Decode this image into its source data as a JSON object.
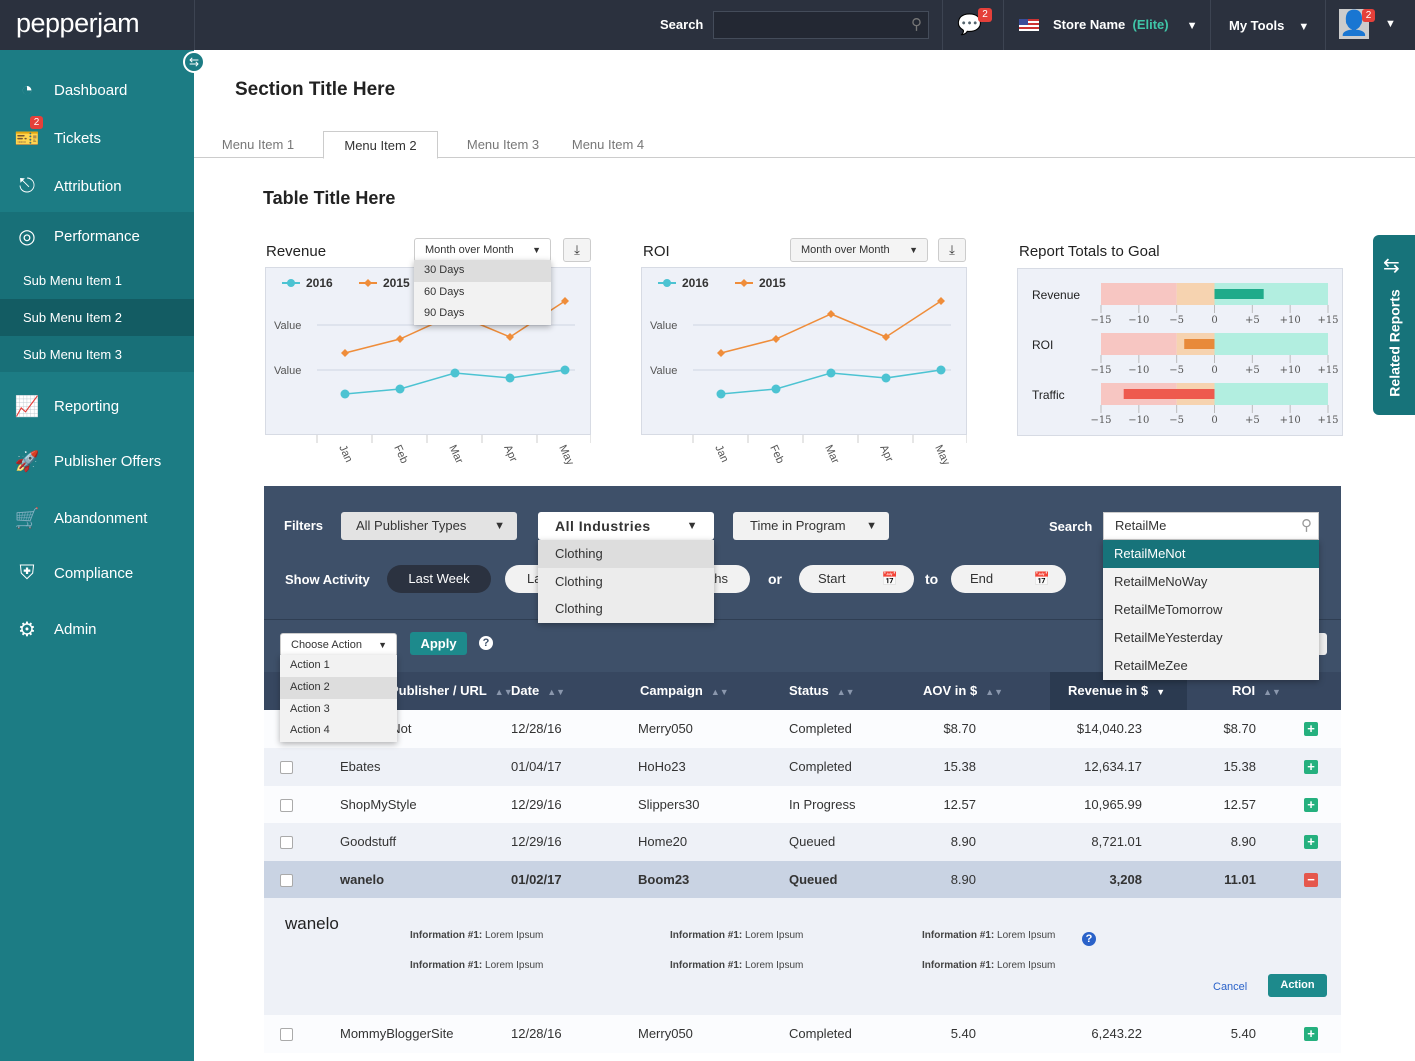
{
  "header": {
    "logo": "pepperjam",
    "search_label": "Search",
    "search_value": "",
    "messages_badge": "2",
    "store_name": "Store Name",
    "store_tier": "(Elite)",
    "my_tools": "My Tools",
    "avatar_badge": "2"
  },
  "sidebar": {
    "items": [
      {
        "label": "Dashboard",
        "icon": "gauge-icon"
      },
      {
        "label": "Tickets",
        "icon": "ticket-icon",
        "badge": "2"
      },
      {
        "label": "Attribution",
        "icon": "attribution-icon"
      },
      {
        "label": "Performance",
        "icon": "target-icon"
      },
      {
        "label": "Reporting",
        "icon": "bar-chart-icon"
      },
      {
        "label": "Publisher Offers",
        "icon": "rocket-icon"
      },
      {
        "label": "Abandonment",
        "icon": "cart-icon"
      },
      {
        "label": "Compliance",
        "icon": "shield-icon"
      },
      {
        "label": "Admin",
        "icon": "gears-icon"
      }
    ],
    "sub_items": [
      "Sub Menu Item 1",
      "Sub Menu Item 2",
      "Sub Menu Item 3"
    ],
    "active_sub": "Sub Menu Item 2"
  },
  "page": {
    "section_title": "Section Title Here",
    "tabs": [
      "Menu Item 1",
      "Menu Item 2",
      "Menu Item 3",
      "Menu Item 4"
    ],
    "active_tab": "Menu Item 2",
    "table_title": "Table Title Here",
    "related_reports": "Related Reports"
  },
  "revenue_card": {
    "title": "Revenue",
    "period": "Month over Month",
    "menu": [
      "30 Days",
      "60 Days",
      "90 Days"
    ]
  },
  "roi_card": {
    "title": "ROI",
    "period": "Month over Month"
  },
  "goal_card": {
    "title": "Report Totals to Goal"
  },
  "chart_data": [
    {
      "type": "line",
      "title": "Revenue",
      "categories": [
        "Jan",
        "Feb",
        "Mar",
        "Apr",
        "May"
      ],
      "ytick_labels": [
        "Value",
        "Value"
      ],
      "legend": "top-left",
      "grid": true,
      "series": [
        {
          "name": "2016",
          "color": "#4cc3d2",
          "values": [
            41,
            46,
            62,
            57,
            65
          ]
        },
        {
          "name": "2015",
          "color": "#ef8d3a",
          "values": [
            82,
            96,
            121,
            98,
            134
          ]
        }
      ]
    },
    {
      "type": "line",
      "title": "ROI",
      "categories": [
        "Jan",
        "Feb",
        "Mar",
        "Apr",
        "May"
      ],
      "ytick_labels": [
        "Value",
        "Value"
      ],
      "legend": "top-left",
      "grid": true,
      "series": [
        {
          "name": "2016",
          "color": "#4cc3d2",
          "values": [
            41,
            46,
            62,
            57,
            65
          ]
        },
        {
          "name": "2015",
          "color": "#ef8d3a",
          "values": [
            82,
            96,
            121,
            98,
            134
          ]
        }
      ]
    },
    {
      "type": "bar",
      "title": "Report Totals to Goal",
      "orientation": "horizontal",
      "xlim": [
        -15,
        15
      ],
      "ticks": [
        "−15",
        "−10",
        "−5",
        "0",
        "+5",
        "+10",
        "+15"
      ],
      "bands": [
        {
          "from": -15,
          "to": -5,
          "color": "#f7c6c2"
        },
        {
          "from": -5,
          "to": 0,
          "color": "#f6d3b0"
        },
        {
          "from": 0,
          "to": 15,
          "color": "#b2eee0"
        }
      ],
      "categories": [
        "Revenue",
        "ROI",
        "Traffic"
      ],
      "values": [
        6.5,
        -4,
        -12
      ],
      "colors": [
        "#1fab8a",
        "#e88a3a",
        "#ee5a4e"
      ]
    }
  ],
  "filters": {
    "label": "Filters",
    "publisher_types": "All Publisher Types",
    "industries": "All Industries",
    "industry_menu": [
      "Clothing",
      "Clothing",
      "Clothing"
    ],
    "time_in_program": "Time in Program",
    "search_label": "Search",
    "search_value": "RetailMe",
    "search_suggestions": [
      "RetailMeNot",
      "RetailMeNoWay",
      "RetailMeTomorrow",
      "RetailMeYesterday",
      "RetailMeZee"
    ],
    "show_activity": "Show Activity",
    "last_week": "Last Week",
    "last_month": "Last Month",
    "last_months": "Last 3 Months",
    "or": "or",
    "start": "Start",
    "to": "to",
    "end": "End"
  },
  "actions": {
    "choose": "Choose Action",
    "menu": [
      "Action 1",
      "Action 2",
      "Action 3",
      "Action 4"
    ],
    "apply": "Apply"
  },
  "table": {
    "headers": [
      "Publisher / URL",
      "Date",
      "Campaign",
      "Status",
      "AOV in $",
      "Revenue in $",
      "ROI"
    ],
    "rows": [
      {
        "name": "RetailMeNot",
        "date": "12/28/16",
        "campaign": "Merry050",
        "status": "Completed",
        "aov": "$8.70",
        "revenue": "$14,040.23",
        "roi": "$8.70"
      },
      {
        "name": "Ebates",
        "date": "01/04/17",
        "campaign": "HoHo23",
        "status": "Completed",
        "aov": "15.38",
        "revenue": "12,634.17",
        "roi": "15.38"
      },
      {
        "name": "ShopMyStyle",
        "date": "12/29/16",
        "campaign": "Slippers30",
        "status": "In Progress",
        "aov": "12.57",
        "revenue": "10,965.99",
        "roi": "12.57"
      },
      {
        "name": "Goodstuff",
        "date": "12/29/16",
        "campaign": "Home20",
        "status": "Queued",
        "aov": "8.90",
        "revenue": "8,721.01",
        "roi": "8.90"
      },
      {
        "name": "wanelo",
        "date": "01/02/17",
        "campaign": "Boom23",
        "status": "Queued",
        "aov": "8.90",
        "revenue": "3,208",
        "roi": "11.01",
        "expanded": true
      },
      {
        "name": "MommyBloggerSite",
        "date": "12/28/16",
        "campaign": "Merry050",
        "status": "Completed",
        "aov": "5.40",
        "revenue": "6,243.22",
        "roi": "5.40"
      }
    ],
    "detail": {
      "title": "wanelo",
      "label": "Information #1:",
      "value": "Lorem Ipsum",
      "cancel": "Cancel",
      "action": "Action"
    }
  }
}
